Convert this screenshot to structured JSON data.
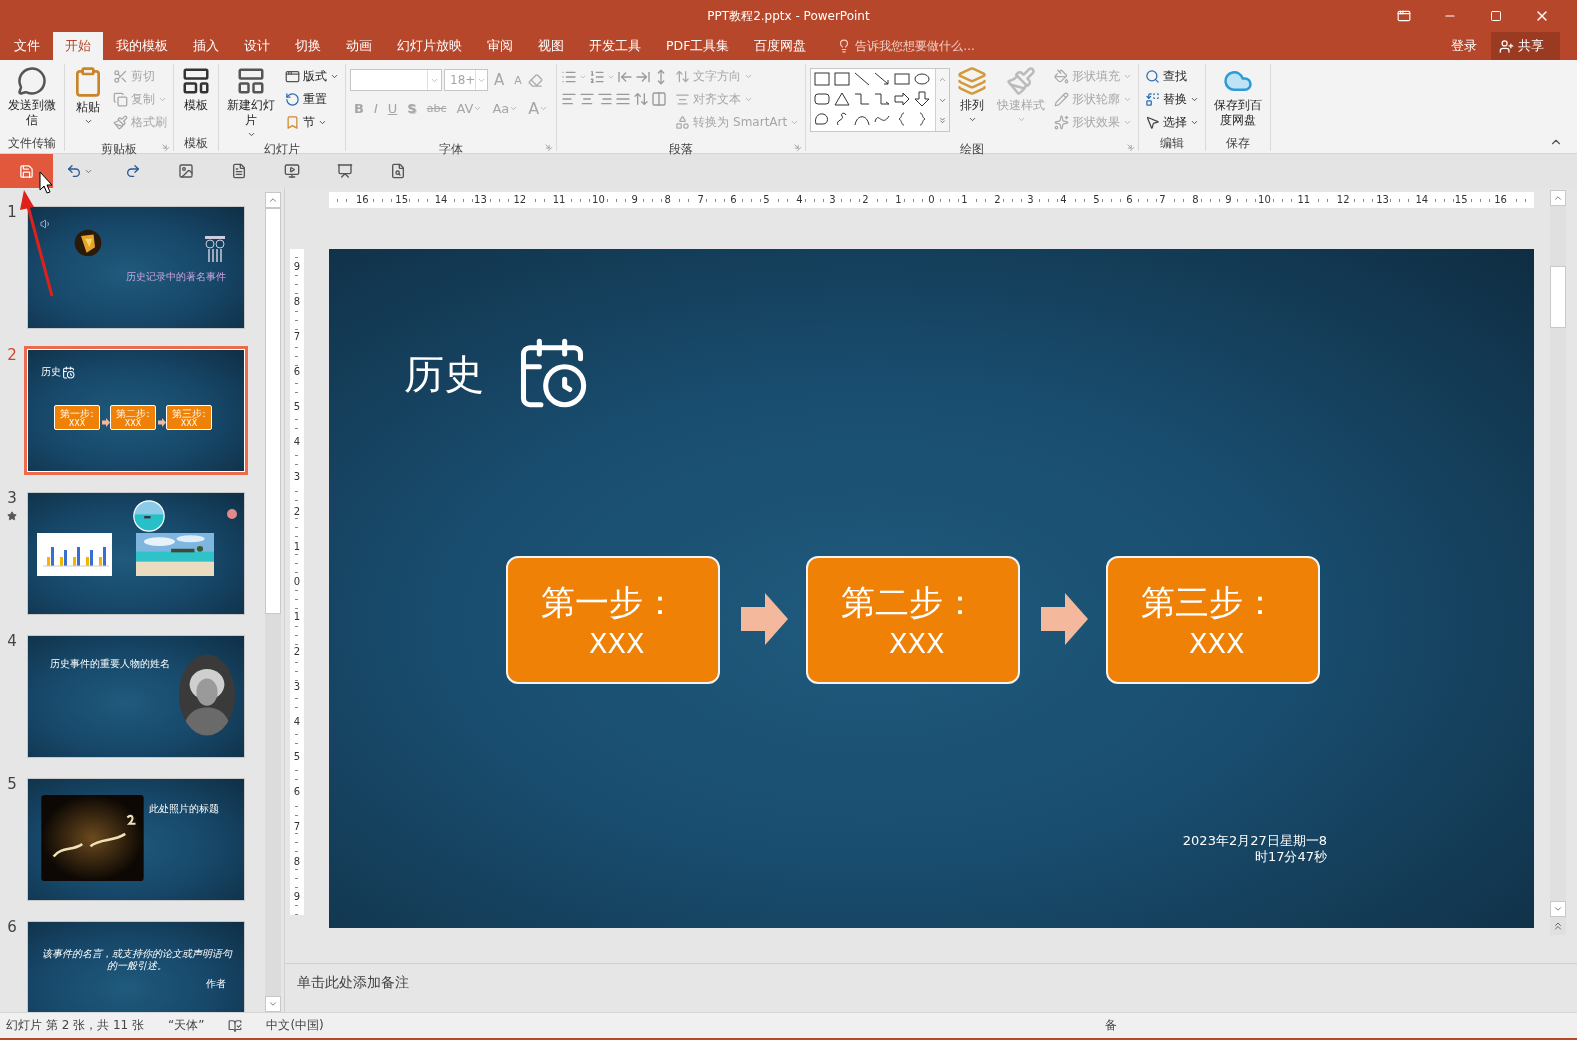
{
  "window": {
    "title": "PPT教程2.pptx - PowerPoint"
  },
  "ribbon_tabs": [
    {
      "label": "文件",
      "selected": false
    },
    {
      "label": "开始",
      "selected": true
    },
    {
      "label": "我的模板",
      "selected": false
    },
    {
      "label": "插入",
      "selected": false
    },
    {
      "label": "设计",
      "selected": false
    },
    {
      "label": "切换",
      "selected": false
    },
    {
      "label": "动画",
      "selected": false
    },
    {
      "label": "幻灯片放映",
      "selected": false
    },
    {
      "label": "审阅",
      "selected": false
    },
    {
      "label": "视图",
      "selected": false
    },
    {
      "label": "开发工具",
      "selected": false
    },
    {
      "label": "PDF工具集",
      "selected": false
    },
    {
      "label": "百度网盘",
      "selected": false
    }
  ],
  "tell_me": {
    "placeholder": "告诉我您想要做什么..."
  },
  "sign_in": "登录",
  "share": "共享",
  "ribbon_groups": [
    {
      "kind": "transfer",
      "label": "文件传输",
      "items": [
        {
          "label": "发送到微信",
          "disabled": false
        }
      ]
    },
    {
      "kind": "clipboard",
      "label": "剪贴板",
      "items": [
        {
          "label": "粘贴",
          "disabled": false
        },
        {
          "label": "剪切",
          "disabled": true
        },
        {
          "label": "复制",
          "disabled": true
        },
        {
          "label": "格式刷",
          "disabled": true
        }
      ]
    },
    {
      "kind": "template",
      "label": "模板",
      "items": [
        {
          "label": "模板",
          "disabled": false
        }
      ]
    },
    {
      "kind": "slides",
      "label": "幻灯片",
      "items": [
        {
          "label": "新建幻灯片",
          "disabled": false
        },
        {
          "label": "版式",
          "disabled": false
        },
        {
          "label": "重置",
          "disabled": false
        },
        {
          "label": "节",
          "disabled": false
        }
      ]
    },
    {
      "kind": "font",
      "label": "字体",
      "size": "18+",
      "items": [
        {
          "label": "A",
          "disabled": true
        },
        {
          "label": "A",
          "disabled": true
        },
        {
          "label": "B",
          "disabled": true
        },
        {
          "label": "I",
          "disabled": true
        },
        {
          "label": "U",
          "disabled": true
        },
        {
          "label": "S",
          "disabled": true
        },
        {
          "label": "abc",
          "disabled": true
        },
        {
          "label": "AV",
          "disabled": true
        },
        {
          "label": "Aa",
          "disabled": true
        },
        {
          "label": "A",
          "disabled": true
        }
      ]
    },
    {
      "kind": "paragraph",
      "label": "段落",
      "items": [
        {
          "label": "文字方向",
          "disabled": true
        },
        {
          "label": "对齐文本",
          "disabled": true
        },
        {
          "label": "转换为 SmartArt",
          "disabled": true
        }
      ]
    },
    {
      "kind": "drawing",
      "label": "绘图",
      "items": [
        {
          "label": "排列",
          "disabled": false
        },
        {
          "label": "快速样式",
          "disabled": true
        },
        {
          "label": "形状填充",
          "disabled": true
        },
        {
          "label": "形状轮廓",
          "disabled": true
        },
        {
          "label": "形状效果",
          "disabled": true
        }
      ]
    },
    {
      "kind": "editing",
      "label": "编辑",
      "items": [
        {
          "label": "查找",
          "disabled": false
        },
        {
          "label": "替换",
          "disabled": false
        },
        {
          "label": "选择",
          "disabled": false
        }
      ]
    },
    {
      "kind": "save",
      "label": "保存",
      "items": [
        {
          "label": "保存到百度网盘",
          "disabled": false
        }
      ]
    }
  ],
  "quick_access": [
    {
      "highlighted": true
    },
    {
      "highlighted": false
    },
    {
      "highlighted": false
    },
    {
      "highlighted": false
    },
    {
      "highlighted": false
    },
    {
      "highlighted": false
    },
    {
      "highlighted": false
    },
    {
      "highlighted": false
    }
  ],
  "slides": [
    {
      "number": "1",
      "selected": false,
      "animated": false,
      "kind": "title",
      "title": "历史记录中的著名事件"
    },
    {
      "number": "2",
      "selected": true,
      "animated": false,
      "kind": "steps",
      "title": "历史",
      "steps": [
        {
          "label": "第一步:",
          "value": "XXX"
        },
        {
          "label": "第二步:",
          "value": "XXX"
        },
        {
          "label": "第三步:",
          "value": "XXX"
        }
      ]
    },
    {
      "number": "3",
      "selected": false,
      "animated": true,
      "kind": "media"
    },
    {
      "number": "4",
      "selected": false,
      "animated": false,
      "kind": "portrait",
      "title": "历史事件的重要人物的姓名"
    },
    {
      "number": "5",
      "selected": false,
      "animated": false,
      "title": "此处照片的标题"
    },
    {
      "number": "6",
      "selected": false,
      "animated": false,
      "kind": "quote",
      "title": "该事件的名言，或支持你的论文或声明语句的一般引述。",
      "author": "作者"
    }
  ],
  "ruler": {
    "horizontal": [
      "16",
      "15",
      "14",
      "13",
      "12",
      "11",
      "10",
      "9",
      "8",
      "7",
      "6",
      "5",
      "4",
      "3",
      "2",
      "1",
      "0",
      "1",
      "2",
      "3",
      "4",
      "5",
      "6",
      "7",
      "8",
      "9",
      "10",
      "11",
      "12",
      "13",
      "14",
      "15",
      "16"
    ],
    "vertical": [
      "9",
      "8",
      "7",
      "6",
      "5",
      "4",
      "3",
      "2",
      "1",
      "0",
      "1",
      "2",
      "3",
      "4",
      "5",
      "6",
      "7",
      "8",
      "9"
    ]
  },
  "current_slide": {
    "title": "历史",
    "steps": [
      {
        "label": "第一步：",
        "value": "XXX"
      },
      {
        "label": "第二步：",
        "value": "XXX"
      },
      {
        "label": "第三步：",
        "value": "XXX"
      }
    ],
    "date": "2023年2月27日星期一8\n时17分47秒"
  },
  "notes": {
    "placeholder": "单击此处添加备注"
  },
  "status_bar": {
    "slide_info": "幻灯片 第 2 张，共 11 张",
    "theme": "“天体”",
    "language": "中文(中国)",
    "notes": "备"
  }
}
